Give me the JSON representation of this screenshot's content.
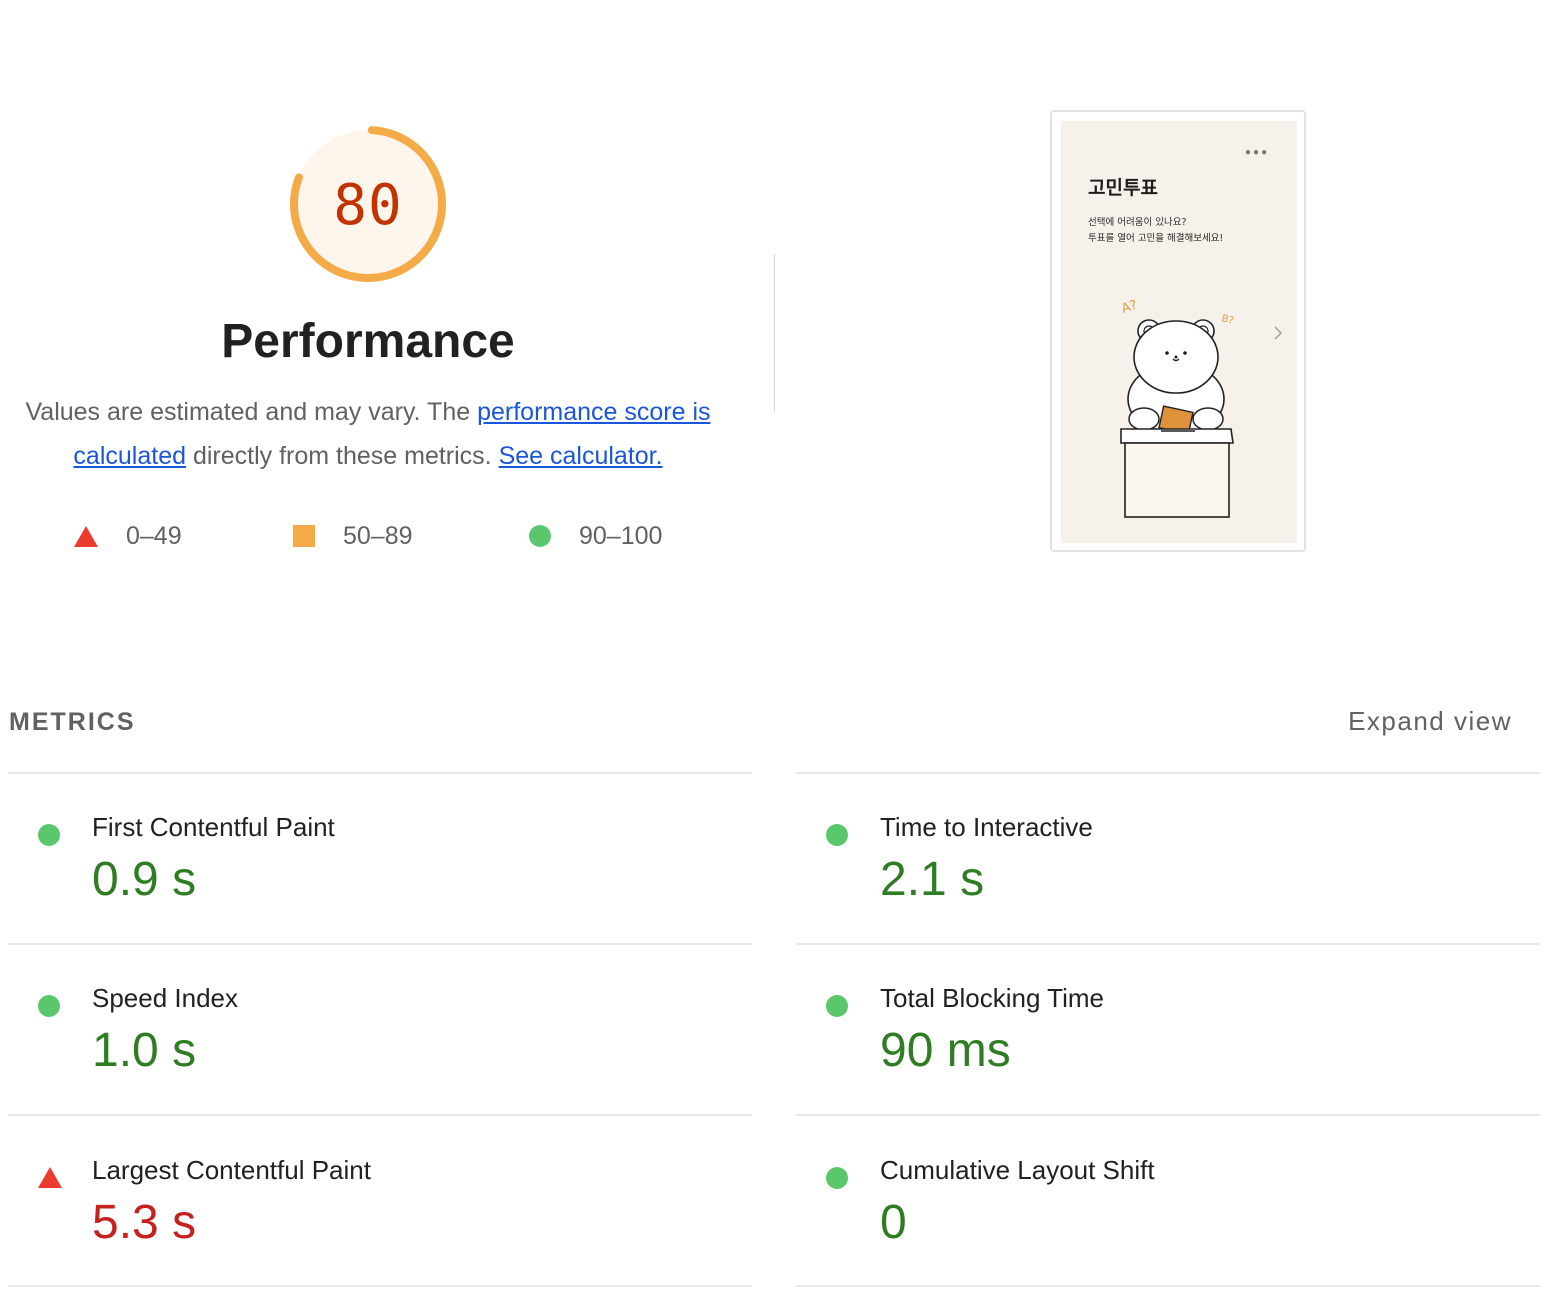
{
  "score": {
    "value": "80",
    "fraction": 0.8,
    "ring_color": "#F4AA47",
    "track_color": "#FEF6EC",
    "text_color": "#C33300"
  },
  "category": {
    "title": "Performance",
    "desc_part1": "Values are estimated and may vary. The ",
    "link_score_calc": "performance score is calculated",
    "desc_part2": " directly from these metrics. ",
    "link_calculator": "See calculator."
  },
  "legend": {
    "fail": "0–49",
    "average": "50–89",
    "pass": "90–100",
    "colors": {
      "fail": "#EB3B2F",
      "average": "#F4AA47",
      "pass": "#5BC76D"
    }
  },
  "screenshot": {
    "app_title": "고민투표",
    "subtitle_line1": "선택에 어려움이 있나요?",
    "subtitle_line2": "투표를 열어 고민을 해결해보세요!",
    "menu_icon": "ellipsis-icon",
    "nav_icon": "chevron-right-icon",
    "label_a": "A?",
    "label_b": "B?"
  },
  "metrics": {
    "header": "METRICS",
    "expand_label": "Expand view",
    "fcp": {
      "label": "First Contentful Paint",
      "value": "0.9 s",
      "rating": "pass"
    },
    "si": {
      "label": "Speed Index",
      "value": "1.0 s",
      "rating": "pass"
    },
    "lcp": {
      "label": "Largest Contentful Paint",
      "value": "5.3 s",
      "rating": "fail"
    },
    "tti": {
      "label": "Time to Interactive",
      "value": "2.1 s",
      "rating": "pass"
    },
    "tbt": {
      "label": "Total Blocking Time",
      "value": "90 ms",
      "rating": "pass"
    },
    "cls": {
      "label": "Cumulative Layout Shift",
      "value": "0",
      "rating": "pass"
    }
  }
}
